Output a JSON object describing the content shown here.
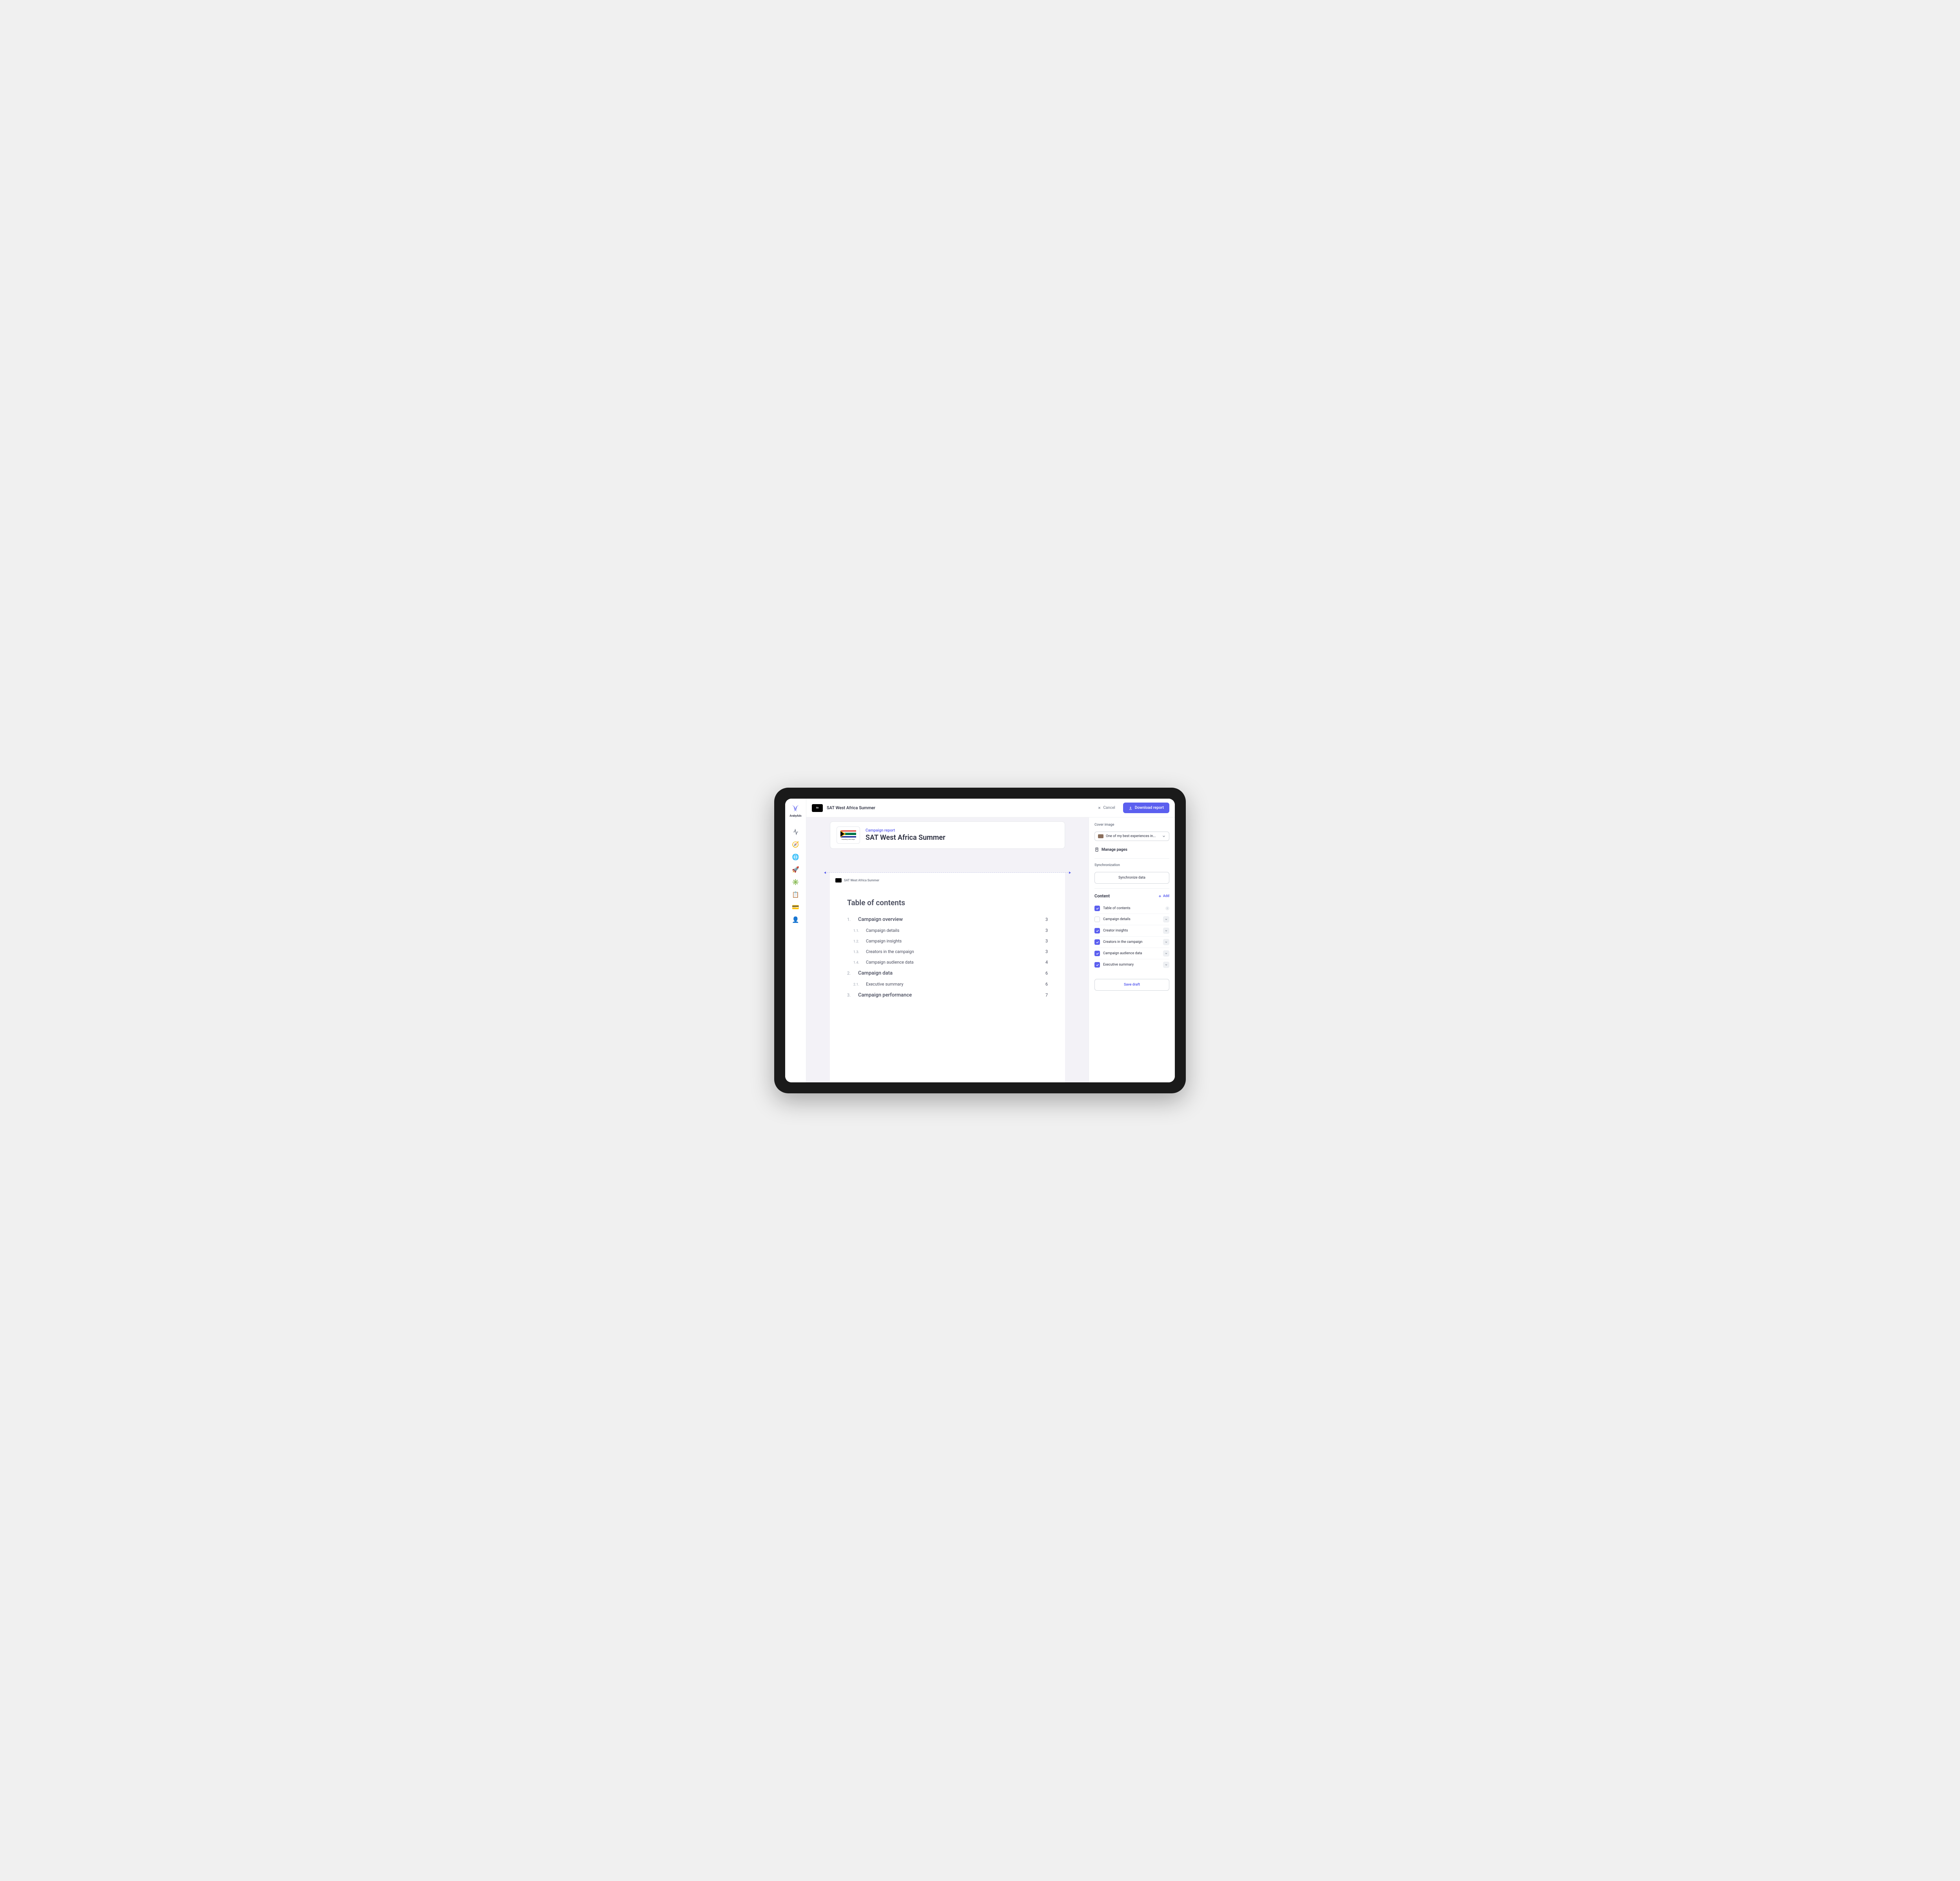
{
  "brand": {
    "name": "ArabyAds"
  },
  "header": {
    "title": "SAT West Africa Summer",
    "cancel": "Cancel",
    "download": "Download report"
  },
  "campaign": {
    "label": "Campaign report",
    "title": "SAT West Africa Summer",
    "page_tag": "SAT West Africa Summer"
  },
  "toc": {
    "title": "Table of contents",
    "sections": [
      {
        "num": "1.",
        "label": "Campaign overview",
        "page": "3"
      },
      {
        "num": "1.1.",
        "label": "Campaign details",
        "page": "3",
        "sub": true
      },
      {
        "num": "1.2.",
        "label": "Campaign insights",
        "page": "3",
        "sub": true
      },
      {
        "num": "1.3.",
        "label": "Creators in the campaign",
        "page": "3",
        "sub": true
      },
      {
        "num": "1.4.",
        "label": "Campaign audience data",
        "page": "4",
        "sub": true
      },
      {
        "num": "2.",
        "label": "Campaign data",
        "page": "6"
      },
      {
        "num": "2.1.",
        "label": "Executive summary",
        "page": "6",
        "sub": true
      },
      {
        "num": "3.",
        "label": "Campaign performance",
        "page": "7"
      }
    ]
  },
  "inspector": {
    "cover_label": "Cover image",
    "cover_value": "One of my best experiences in...",
    "manage_pages": "Manage pages",
    "sync_label": "Synchronization",
    "sync_button": "Synchronize data",
    "content_title": "Content",
    "add_label": "Add",
    "save_draft": "Save draft",
    "items": [
      {
        "label": "Table of contents",
        "checked": true,
        "info": true,
        "expandable": false
      },
      {
        "label": "Campaign details",
        "checked": false,
        "expandable": true
      },
      {
        "label": "Creator insights",
        "checked": true,
        "expandable": true
      },
      {
        "label": "Creators in the campaign",
        "checked": true,
        "expandable": true
      },
      {
        "label": "Campaign audience data",
        "checked": true,
        "expandable": true
      },
      {
        "label": "Executive summary",
        "checked": true,
        "expandable": true
      }
    ]
  }
}
